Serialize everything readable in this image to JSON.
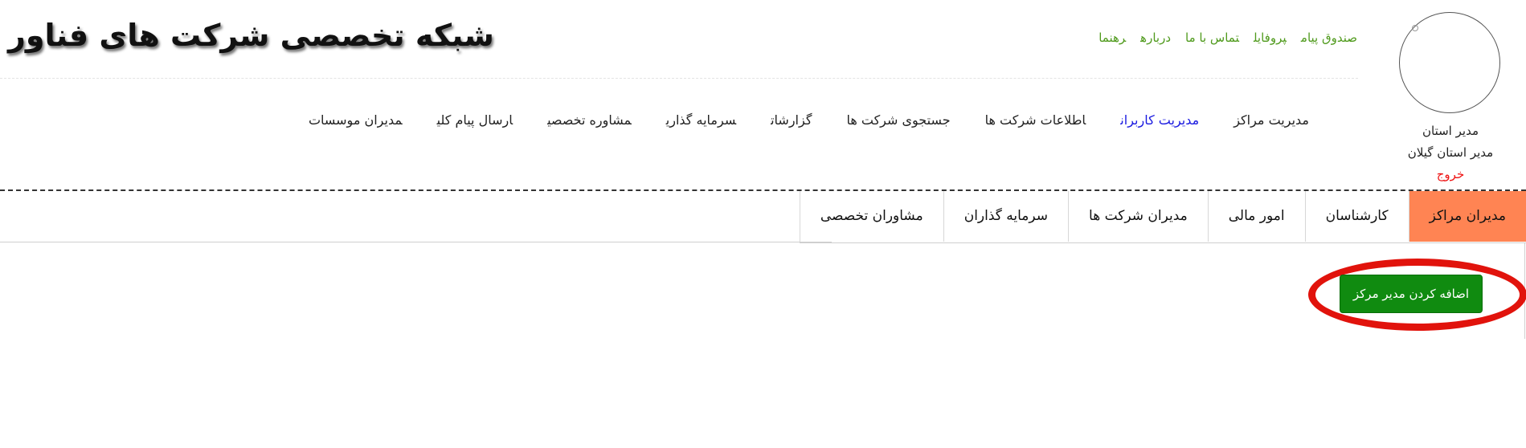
{
  "header": {
    "logo_text": "شبکه تخصصی شرکت های فناور",
    "top_links": [
      "صندوق پیام",
      "پروفایل",
      "تماس با ما",
      "درباره",
      "رهنما"
    ]
  },
  "user": {
    "role": "مدیر استان",
    "title": "مدیر استان گیلان",
    "logout": "خروج"
  },
  "main_nav": {
    "items": [
      "مدیریت مراکز",
      "مدیریت کاربران",
      "اطلاعات شرکت ها",
      "جستجوی شرکت ها",
      "گزارشات",
      "سرمایه گذاری",
      "مشاوره تخصصی",
      "ارسال پیام کلی",
      "مدیران موسسات"
    ],
    "active_index": 1
  },
  "subtabs": {
    "items": [
      "مدیران مراکز",
      "کارشناسان",
      "امور مالی",
      "مدیران شرکت ها",
      "سرمایه گذاران",
      "مشاوران تخصصی"
    ],
    "active_index": 0
  },
  "actions": {
    "add_center_manager": "اضافه کردن مدیر مرکز"
  },
  "colors": {
    "active_tab": "#ff8453",
    "add_button": "#108b10",
    "highlight": "#e1130c",
    "link_green": "#4f9a1c",
    "active_nav": "#1a1ae0"
  }
}
